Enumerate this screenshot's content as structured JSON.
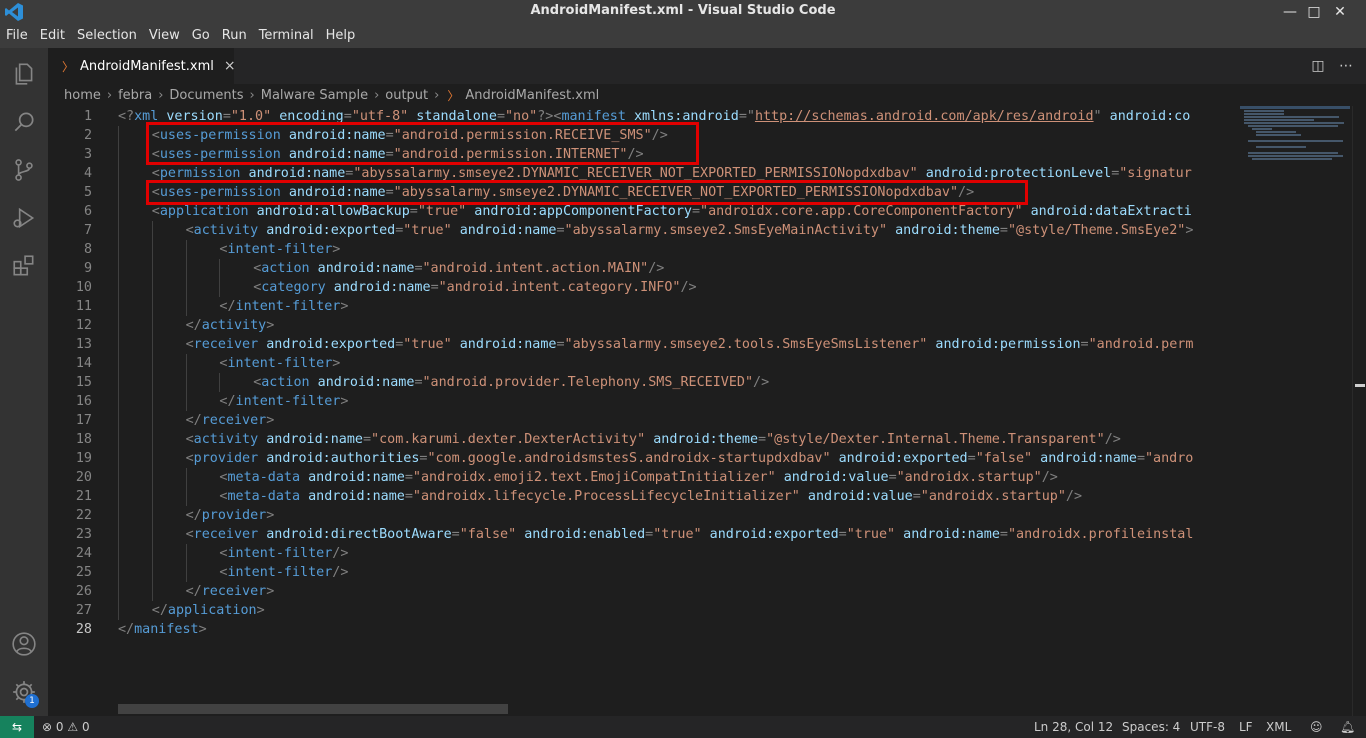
{
  "window": {
    "title": "AndroidManifest.xml - Visual Studio Code"
  },
  "menu": [
    "File",
    "Edit",
    "Selection",
    "View",
    "Go",
    "Run",
    "Terminal",
    "Help"
  ],
  "tab": {
    "label": "AndroidManifest.xml",
    "close": "×"
  },
  "breadcrumb": [
    "home",
    "febra",
    "Documents",
    "Malware Sample",
    "output",
    "AndroidManifest.xml"
  ],
  "activity": {
    "settings_badge": "1"
  },
  "status": {
    "errors": "0",
    "warnings": "0",
    "position": "Ln 28, Col 12",
    "spaces": "Spaces: 4",
    "encoding": "UTF-8",
    "eol": "LF",
    "language": "XML"
  },
  "editor": {
    "current_line": 28,
    "lines": [
      {
        "n": "1",
        "indent": 0,
        "tokens": [
          [
            "pn",
            "<?"
          ],
          [
            "tg",
            "xml"
          ],
          [
            "an",
            " version"
          ],
          [
            "pn",
            "="
          ],
          [
            "av",
            "\"1.0\""
          ],
          [
            "an",
            " encoding"
          ],
          [
            "pn",
            "="
          ],
          [
            "av",
            "\"utf-8\""
          ],
          [
            "an",
            " standalone"
          ],
          [
            "pn",
            "="
          ],
          [
            "av",
            "\"no\""
          ],
          [
            "pn",
            "?><"
          ],
          [
            "tg",
            "manifest"
          ],
          [
            "an",
            " xmlns:android"
          ],
          [
            "pn",
            "="
          ],
          [
            "pn",
            "\""
          ],
          [
            "avu",
            "http://schemas.android.com/apk/res/android"
          ],
          [
            "pn",
            "\""
          ],
          [
            "an",
            " android:co"
          ]
        ]
      },
      {
        "n": "2",
        "indent": 1,
        "tokens": [
          [
            "pn",
            "<"
          ],
          [
            "tg",
            "uses-permission"
          ],
          [
            "an",
            " android:name"
          ],
          [
            "pn",
            "="
          ],
          [
            "av",
            "\"android.permission.RECEIVE_SMS\""
          ],
          [
            "pn",
            "/>"
          ]
        ]
      },
      {
        "n": "3",
        "indent": 1,
        "tokens": [
          [
            "pn",
            "<"
          ],
          [
            "tg",
            "uses-permission"
          ],
          [
            "an",
            " android:name"
          ],
          [
            "pn",
            "="
          ],
          [
            "av",
            "\"android.permission.INTERNET\""
          ],
          [
            "pn",
            "/>"
          ]
        ]
      },
      {
        "n": "4",
        "indent": 1,
        "tokens": [
          [
            "pn",
            "<"
          ],
          [
            "tg",
            "permission"
          ],
          [
            "an",
            " android:name"
          ],
          [
            "pn",
            "="
          ],
          [
            "av",
            "\"abyssalarmy.smseye2.DYNAMIC_RECEIVER_NOT_EXPORTED_PERMISSIONopdxdbav\""
          ],
          [
            "an",
            " android:protectionLevel"
          ],
          [
            "pn",
            "="
          ],
          [
            "av",
            "\"signatur"
          ]
        ]
      },
      {
        "n": "5",
        "indent": 1,
        "tokens": [
          [
            "pn",
            "<"
          ],
          [
            "tg",
            "uses-permission"
          ],
          [
            "an",
            " android:name"
          ],
          [
            "pn",
            "="
          ],
          [
            "av",
            "\"abyssalarmy.smseye2.DYNAMIC_RECEIVER_NOT_EXPORTED_PERMISSIONopdxdbav\""
          ],
          [
            "pn",
            "/>"
          ]
        ]
      },
      {
        "n": "6",
        "indent": 1,
        "tokens": [
          [
            "pn",
            "<"
          ],
          [
            "tg",
            "application"
          ],
          [
            "an",
            " android:allowBackup"
          ],
          [
            "pn",
            "="
          ],
          [
            "av",
            "\"true\""
          ],
          [
            "an",
            " android:appComponentFactory"
          ],
          [
            "pn",
            "="
          ],
          [
            "av",
            "\"androidx.core.app.CoreComponentFactory\""
          ],
          [
            "an",
            " android:dataExtracti"
          ]
        ]
      },
      {
        "n": "7",
        "indent": 2,
        "tokens": [
          [
            "pn",
            "<"
          ],
          [
            "tg",
            "activity"
          ],
          [
            "an",
            " android:exported"
          ],
          [
            "pn",
            "="
          ],
          [
            "av",
            "\"true\""
          ],
          [
            "an",
            " android:name"
          ],
          [
            "pn",
            "="
          ],
          [
            "av",
            "\"abyssalarmy.smseye2.SmsEyeMainActivity\""
          ],
          [
            "an",
            " android:theme"
          ],
          [
            "pn",
            "="
          ],
          [
            "av",
            "\"@style/Theme.SmsEye2\""
          ],
          [
            "pn",
            ">"
          ]
        ]
      },
      {
        "n": "8",
        "indent": 3,
        "tokens": [
          [
            "pn",
            "<"
          ],
          [
            "tg",
            "intent-filter"
          ],
          [
            "pn",
            ">"
          ]
        ]
      },
      {
        "n": "9",
        "indent": 4,
        "tokens": [
          [
            "pn",
            "<"
          ],
          [
            "tg",
            "action"
          ],
          [
            "an",
            " android:name"
          ],
          [
            "pn",
            "="
          ],
          [
            "av",
            "\"android.intent.action.MAIN\""
          ],
          [
            "pn",
            "/>"
          ]
        ]
      },
      {
        "n": "10",
        "indent": 4,
        "tokens": [
          [
            "pn",
            "<"
          ],
          [
            "tg",
            "category"
          ],
          [
            "an",
            " android:name"
          ],
          [
            "pn",
            "="
          ],
          [
            "av",
            "\"android.intent.category.INFO\""
          ],
          [
            "pn",
            "/>"
          ]
        ]
      },
      {
        "n": "11",
        "indent": 3,
        "tokens": [
          [
            "pn",
            "</"
          ],
          [
            "tg",
            "intent-filter"
          ],
          [
            "pn",
            ">"
          ]
        ]
      },
      {
        "n": "12",
        "indent": 2,
        "tokens": [
          [
            "pn",
            "</"
          ],
          [
            "tg",
            "activity"
          ],
          [
            "pn",
            ">"
          ]
        ]
      },
      {
        "n": "13",
        "indent": 2,
        "tokens": [
          [
            "pn",
            "<"
          ],
          [
            "tg",
            "receiver"
          ],
          [
            "an",
            " android:exported"
          ],
          [
            "pn",
            "="
          ],
          [
            "av",
            "\"true\""
          ],
          [
            "an",
            " android:name"
          ],
          [
            "pn",
            "="
          ],
          [
            "av",
            "\"abyssalarmy.smseye2.tools.SmsEyeSmsListener\""
          ],
          [
            "an",
            " android:permission"
          ],
          [
            "pn",
            "="
          ],
          [
            "av",
            "\"android.perm"
          ]
        ]
      },
      {
        "n": "14",
        "indent": 3,
        "tokens": [
          [
            "pn",
            "<"
          ],
          [
            "tg",
            "intent-filter"
          ],
          [
            "pn",
            ">"
          ]
        ]
      },
      {
        "n": "15",
        "indent": 4,
        "tokens": [
          [
            "pn",
            "<"
          ],
          [
            "tg",
            "action"
          ],
          [
            "an",
            " android:name"
          ],
          [
            "pn",
            "="
          ],
          [
            "av",
            "\"android.provider.Telephony.SMS_RECEIVED\""
          ],
          [
            "pn",
            "/>"
          ]
        ]
      },
      {
        "n": "16",
        "indent": 3,
        "tokens": [
          [
            "pn",
            "</"
          ],
          [
            "tg",
            "intent-filter"
          ],
          [
            "pn",
            ">"
          ]
        ]
      },
      {
        "n": "17",
        "indent": 2,
        "tokens": [
          [
            "pn",
            "</"
          ],
          [
            "tg",
            "receiver"
          ],
          [
            "pn",
            ">"
          ]
        ]
      },
      {
        "n": "18",
        "indent": 2,
        "tokens": [
          [
            "pn",
            "<"
          ],
          [
            "tg",
            "activity"
          ],
          [
            "an",
            " android:name"
          ],
          [
            "pn",
            "="
          ],
          [
            "av",
            "\"com.karumi.dexter.DexterActivity\""
          ],
          [
            "an",
            " android:theme"
          ],
          [
            "pn",
            "="
          ],
          [
            "av",
            "\"@style/Dexter.Internal.Theme.Transparent\""
          ],
          [
            "pn",
            "/>"
          ]
        ]
      },
      {
        "n": "19",
        "indent": 2,
        "tokens": [
          [
            "pn",
            "<"
          ],
          [
            "tg",
            "provider"
          ],
          [
            "an",
            " android:authorities"
          ],
          [
            "pn",
            "="
          ],
          [
            "av",
            "\"com.google.androidsmstesS.androidx-startupdxdbav\""
          ],
          [
            "an",
            " android:exported"
          ],
          [
            "pn",
            "="
          ],
          [
            "av",
            "\"false\""
          ],
          [
            "an",
            " android:name"
          ],
          [
            "pn",
            "="
          ],
          [
            "av",
            "\"andro"
          ]
        ]
      },
      {
        "n": "20",
        "indent": 3,
        "tokens": [
          [
            "pn",
            "<"
          ],
          [
            "tg",
            "meta-data"
          ],
          [
            "an",
            " android:name"
          ],
          [
            "pn",
            "="
          ],
          [
            "av",
            "\"androidx.emoji2.text.EmojiCompatInitializer\""
          ],
          [
            "an",
            " android:value"
          ],
          [
            "pn",
            "="
          ],
          [
            "av",
            "\"androidx.startup\""
          ],
          [
            "pn",
            "/>"
          ]
        ]
      },
      {
        "n": "21",
        "indent": 3,
        "tokens": [
          [
            "pn",
            "<"
          ],
          [
            "tg",
            "meta-data"
          ],
          [
            "an",
            " android:name"
          ],
          [
            "pn",
            "="
          ],
          [
            "av",
            "\"androidx.lifecycle.ProcessLifecycleInitializer\""
          ],
          [
            "an",
            " android:value"
          ],
          [
            "pn",
            "="
          ],
          [
            "av",
            "\"androidx.startup\""
          ],
          [
            "pn",
            "/>"
          ]
        ]
      },
      {
        "n": "22",
        "indent": 2,
        "tokens": [
          [
            "pn",
            "</"
          ],
          [
            "tg",
            "provider"
          ],
          [
            "pn",
            ">"
          ]
        ]
      },
      {
        "n": "23",
        "indent": 2,
        "tokens": [
          [
            "pn",
            "<"
          ],
          [
            "tg",
            "receiver"
          ],
          [
            "an",
            " android:directBootAware"
          ],
          [
            "pn",
            "="
          ],
          [
            "av",
            "\"false\""
          ],
          [
            "an",
            " android:enabled"
          ],
          [
            "pn",
            "="
          ],
          [
            "av",
            "\"true\""
          ],
          [
            "an",
            " android:exported"
          ],
          [
            "pn",
            "="
          ],
          [
            "av",
            "\"true\""
          ],
          [
            "an",
            " android:name"
          ],
          [
            "pn",
            "="
          ],
          [
            "av",
            "\"androidx.profileinstal"
          ]
        ]
      },
      {
        "n": "24",
        "indent": 3,
        "tokens": [
          [
            "pn",
            "<"
          ],
          [
            "tg",
            "intent-filter"
          ],
          [
            "pn",
            "/>"
          ]
        ]
      },
      {
        "n": "25",
        "indent": 3,
        "tokens": [
          [
            "pn",
            "<"
          ],
          [
            "tg",
            "intent-filter"
          ],
          [
            "pn",
            "/>"
          ]
        ]
      },
      {
        "n": "26",
        "indent": 2,
        "tokens": [
          [
            "pn",
            "</"
          ],
          [
            "tg",
            "receiver"
          ],
          [
            "pn",
            ">"
          ]
        ]
      },
      {
        "n": "27",
        "indent": 1,
        "tokens": [
          [
            "pn",
            "</"
          ],
          [
            "tg",
            "application"
          ],
          [
            "pn",
            ">"
          ]
        ]
      },
      {
        "n": "28",
        "indent": 0,
        "tokens": [
          [
            "pn",
            "</"
          ],
          [
            "tg",
            "manifest"
          ],
          [
            "pn",
            ">"
          ]
        ]
      }
    ]
  }
}
